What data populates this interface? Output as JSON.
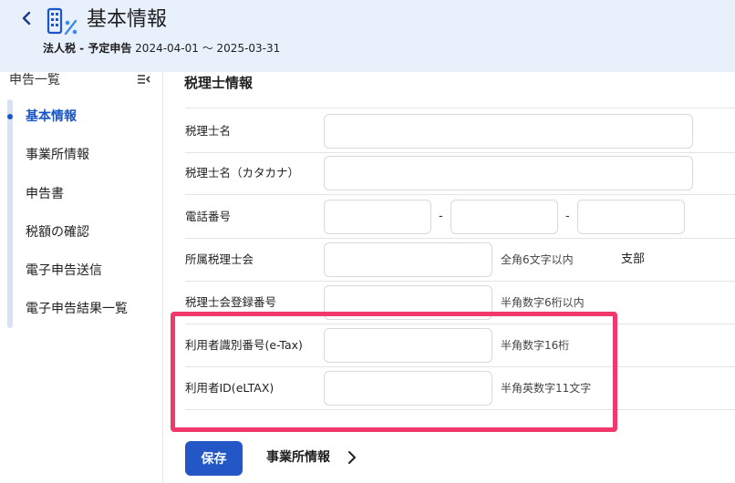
{
  "header": {
    "back_icon": "chevron-left-icon",
    "app_icon": "tax-form-icon",
    "title": "基本情報",
    "tax_type": "法人税 - 予定申告",
    "period": "2024-04-01 ～ 2025-03-31"
  },
  "sidebar": {
    "heading": "申告一覧",
    "collapse_icon": "collapse-menu-icon",
    "items": [
      {
        "label": "基本情報",
        "active": true
      },
      {
        "label": "事業所情報",
        "active": false
      },
      {
        "label": "申告書",
        "active": false
      },
      {
        "label": "税額の確認",
        "active": false
      },
      {
        "label": "電子申告送信",
        "active": false
      },
      {
        "label": "電子申告結果一覧",
        "active": false
      }
    ]
  },
  "form": {
    "section_title": "税理士情報",
    "rows": {
      "name": {
        "label": "税理士名",
        "value": ""
      },
      "name_kana": {
        "label": "税理士名（カタカナ）",
        "value": ""
      },
      "phone": {
        "label": "電話番号",
        "dash": "-",
        "part1": "",
        "part2": "",
        "part3": ""
      },
      "association": {
        "label": "所属税理士会",
        "value": "",
        "hint": "全角6文字以内",
        "suffix": "支部"
      },
      "registration": {
        "label": "税理士会登録番号",
        "value": "",
        "hint": "半角数字6桁以内"
      },
      "etax_id": {
        "label": "利用者識別番号(e-Tax)",
        "value": "",
        "hint": "半角数字16桁"
      },
      "eltax_id": {
        "label": "利用者ID(eLTAX)",
        "value": "",
        "hint": "半角英数字11文字"
      }
    }
  },
  "footer": {
    "save_label": "保存",
    "next_label": "事業所情報",
    "next_icon": "chevron-right-icon"
  },
  "colors": {
    "accent": "#2357c6",
    "header_bg": "#e8f0fb",
    "highlight": "#f0386b"
  }
}
